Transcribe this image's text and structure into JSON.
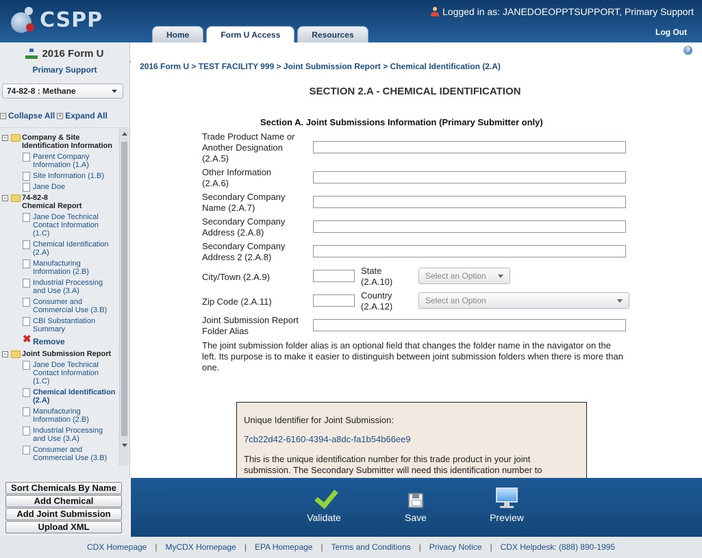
{
  "app": {
    "logo_text": "CSPP"
  },
  "header": {
    "logged_in": "Logged in as: JANEDOEOPPTSUPPORT, Primary Support",
    "logout": "Log Out",
    "tabs": [
      {
        "label": "Home"
      },
      {
        "label": "Form U Access"
      },
      {
        "label": "Resources"
      }
    ]
  },
  "sidebar": {
    "title": "2016 Form U",
    "subtitle": "Primary Support",
    "chemical_select": "74-82-8 : Methane",
    "collapse_all": "Collapse All",
    "expand_all": "Expand All",
    "tree": {
      "group1": "Company & Site Identification Information",
      "parent_company": "Parent Company Information (1.A)",
      "site_info": "Site Information (1.B)",
      "jane_doe": "Jane Doe",
      "group2_line1": "74-82-8",
      "group2_line2": "Chemical Report",
      "tech_contact": "Jane Doe Technical Contact Information (1.C)",
      "chem_ident": "Chemical Identification (2.A)",
      "manufacturing": "Manufacturing Information (2.B)",
      "industrial": "Industrial Processing and Use (3.A)",
      "consumer": "Consumer and Commercial Use (3.B)",
      "cbi": "CBI Substantiation Summary",
      "remove": "Remove",
      "group3": "Joint Submission Report",
      "js_tech_contact": "Jane Doe Technical Contact Information (1.C)",
      "js_chem_ident": "Chemical Identification (2.A)",
      "js_manufacturing": "Manufacturing Information (2.B)",
      "js_industrial": "Industrial Processing and Use (3.A)",
      "js_consumer": "Consumer and Commercial Use (3.B)"
    },
    "buttons": {
      "sort": "Sort Chemicals By Name",
      "add_chemical": "Add Chemical",
      "add_joint": "Add Joint Submission",
      "upload": "Upload XML"
    }
  },
  "main": {
    "breadcrumb": "2016 Form U > TEST FACILITY 999 > Joint Submission Report > Chemical Identification (2.A)",
    "page_title": "SECTION 2.A - CHEMICAL IDENTIFICATION",
    "section_title": "Section A. Joint Submissions Information (Primary Submitter only)",
    "fields": {
      "trade_name": "Trade Product Name or Another Designation (2.A.5)",
      "other_info": "Other Information (2.A.6)",
      "sec_company": "Secondary Company Name (2.A.7)",
      "sec_address": "Secondary Company Address (2.A.8)",
      "sec_address2": "Secondary Company Address 2 (2.A.8)",
      "city": "City/Town (2.A.9)",
      "state": "State (2.A.10)",
      "zip": "Zip Code (2.A.11)",
      "country": "Country (2.A.12)",
      "folder_alias": "Joint Submission Report Folder Alias"
    },
    "select_placeholder": "Select an Option",
    "alias_note": "The joint submission folder alias is an optional field that changes the folder name in the navigator on the left. Its purpose is to make it easier to distinguish between joint submission folders when there is more than one.",
    "uid": {
      "label": "Unique Identifier for Joint Submission:",
      "value": "7cb22d42-6160-4394-a8dc-fa1b54b66ee9",
      "desc": "This is the unique identification number for this trade product in your joint submission. The Secondary Submitter will need this identification number to"
    }
  },
  "actions": {
    "validate": "Validate",
    "save": "Save",
    "preview": "Preview"
  },
  "footer": {
    "links": [
      "CDX Homepage",
      "MyCDX Homepage",
      "EPA Homepage",
      "Terms and Conditions",
      "Privacy Notice",
      "CDX Helpdesk: (888) 890-1995"
    ]
  }
}
